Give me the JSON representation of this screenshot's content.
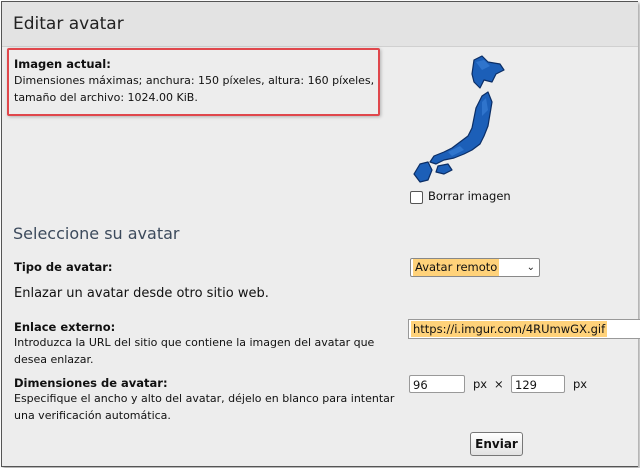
{
  "header": {
    "title": "Editar avatar"
  },
  "current_image": {
    "heading": "Imagen actual:",
    "line1": "Dimensiones máximas; anchura: 150 píxeles, altura: 160 píxeles,",
    "line2": "tamaño del archivo: 1024.00 KiB.",
    "icon": "japan-map-image"
  },
  "delete_image": {
    "label": "Borrar imagen",
    "checked": false
  },
  "section": {
    "title": "Seleccione su avatar"
  },
  "avatar_type": {
    "label": "Tipo de avatar:",
    "selected": "Avatar remoto",
    "description": "Enlazar un avatar desde otro sitio web."
  },
  "external_link": {
    "label": "Enlace externo:",
    "help1": "Introduzca la URL del sitio que contiene la imagen del avatar que",
    "help2": "desea enlazar.",
    "value": "https://i.imgur.com/4RUmwGX.gif"
  },
  "dimensions": {
    "label": "Dimensiones de avatar:",
    "help1": "Especifique el ancho y alto del avatar, déjelo en blanco para intentar",
    "help2": "una verificación automática.",
    "width": "96",
    "height": "129",
    "unit": "px",
    "separator": "×"
  },
  "submit": {
    "label": "Enviar"
  },
  "colors": {
    "highlight": "#ffd27a",
    "outline": "#e0474c",
    "map_blue": "#1c5fb8",
    "section_title": "#3c4a5c"
  }
}
